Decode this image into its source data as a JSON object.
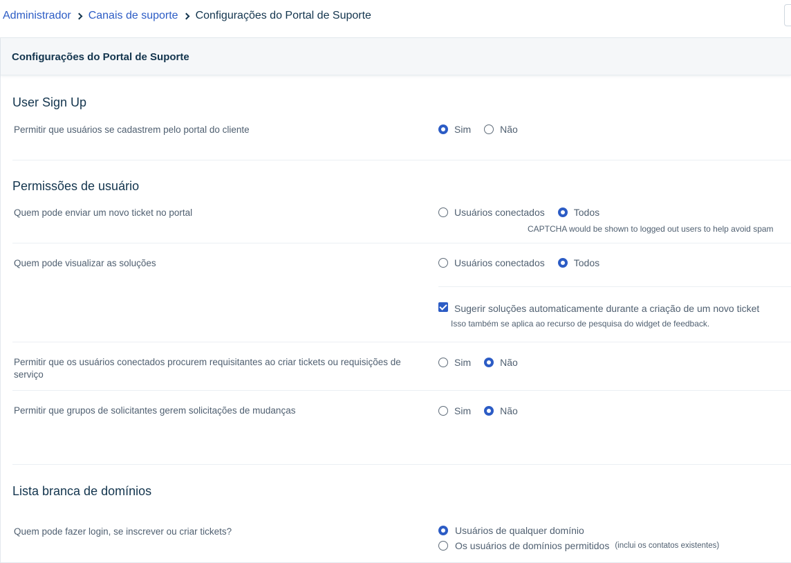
{
  "breadcrumb": {
    "items": [
      "Administrador",
      "Canais de suporte"
    ],
    "current": "Configurações do Portal de Suporte"
  },
  "panel": {
    "title": "Configurações do Portal de Suporte"
  },
  "signup": {
    "title": "User Sign Up",
    "allow_label": "Permitir que usuários se cadastrem pelo portal do cliente",
    "options": [
      "Sim",
      "Não"
    ],
    "selected": "Sim"
  },
  "permissions": {
    "title": "Permissões de usuário",
    "submit_ticket": {
      "label": "Quem pode enviar um novo ticket no portal",
      "options": [
        "Usuários conectados",
        "Todos"
      ],
      "selected": "Todos",
      "hint": "CAPTCHA would be shown to logged out users to help avoid spam"
    },
    "view_solutions": {
      "label": "Quem pode visualizar as soluções",
      "options": [
        "Usuários conectados",
        "Todos"
      ],
      "selected": "Todos"
    },
    "suggest_solutions": {
      "label": "Sugerir soluções automaticamente durante a criação de um novo ticket",
      "hint": "Isso também se aplica ao recurso de pesquisa do widget de feedback.",
      "checked": true
    },
    "search_requesters": {
      "label": "Permitir que os usuários conectados procurem requisitantes ao criar tickets ou requisições de serviço",
      "options": [
        "Sim",
        "Não"
      ],
      "selected": "Não"
    },
    "requester_groups": {
      "label": "Permitir que grupos de solicitantes gerem solicitações de mudanças",
      "options": [
        "Sim",
        "Não"
      ],
      "selected": "Não"
    }
  },
  "whitelist": {
    "title": "Lista branca de domínios",
    "label": "Quem pode fazer login, se inscrever ou criar tickets?",
    "option_any": "Usuários de qualquer domínio",
    "option_allowed": "Os usuários de domínios permitidos",
    "option_allowed_note": "(inclui os contatos existentes)",
    "selected": "option_any"
  },
  "colors": {
    "accent": "#2c5cc5",
    "heading": "#12344d",
    "text": "#4f5f70"
  }
}
